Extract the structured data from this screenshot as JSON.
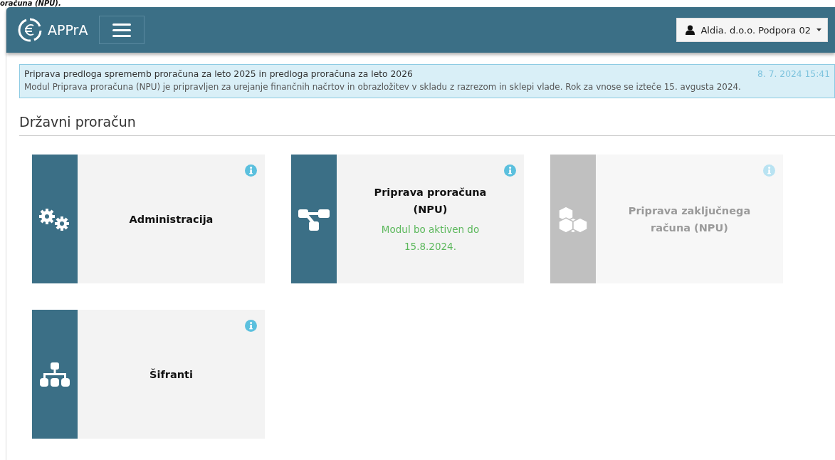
{
  "document_fragment": "oračuna (NPU).",
  "header": {
    "app_name": "APPrA",
    "user": "Aldia. d.o.o. Podpora 02"
  },
  "notice": {
    "title": "Priprava predloga sprememb proračuna za leto 2025 in predloga proračuna za leto 2026",
    "timestamp": "8. 7. 2024 15:41",
    "text": "Modul Priprava proračuna (NPU) je pripravljen za urejanje finančnih načrtov in obrazložitev v skladu z razrezom in sklepi vlade. Rok za vnose se izteče 15. avgusta 2024."
  },
  "section_title": "Državni proračun",
  "modules": [
    {
      "title": "Administracija",
      "disabled": false
    },
    {
      "title": "Priprava proračuna (NPU)",
      "note": "Modul bo aktiven do 15.8.2024.",
      "disabled": false
    },
    {
      "title": "Priprava zaključnega računa (NPU)",
      "disabled": true
    },
    {
      "title": "Šifranti",
      "disabled": false
    }
  ]
}
